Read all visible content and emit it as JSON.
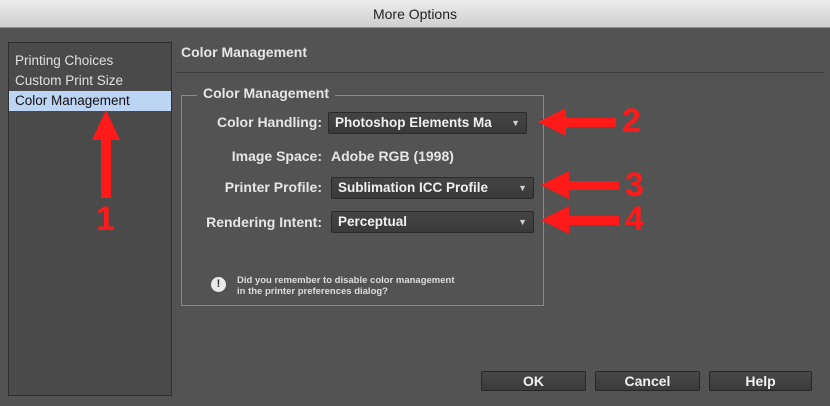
{
  "window": {
    "title": "More Options"
  },
  "sidebar": {
    "items": [
      {
        "label": "Printing Choices"
      },
      {
        "label": "Custom Print Size"
      },
      {
        "label": "Color Management"
      }
    ],
    "selected_index": 2
  },
  "pane": {
    "title": "Color Management"
  },
  "group": {
    "title": "Color Management",
    "color_handling": {
      "label": "Color Handling:",
      "value": "Photoshop Elements Ma"
    },
    "image_space": {
      "label": "Image Space:",
      "value": "Adobe RGB (1998)"
    },
    "printer_profile": {
      "label": "Printer Profile:",
      "value": "Sublimation ICC Profile"
    },
    "rendering_intent": {
      "label": "Rendering Intent:",
      "value": "Perceptual"
    },
    "warning": {
      "icon": "exclamation-icon",
      "line1": "Did you remember to disable color management",
      "line2": "in the printer preferences dialog?"
    }
  },
  "buttons": {
    "ok": "OK",
    "cancel": "Cancel",
    "help": "Help"
  },
  "annotations": {
    "one": "1",
    "two": "2",
    "three": "3",
    "four": "4",
    "color": "#ff1a1a"
  }
}
